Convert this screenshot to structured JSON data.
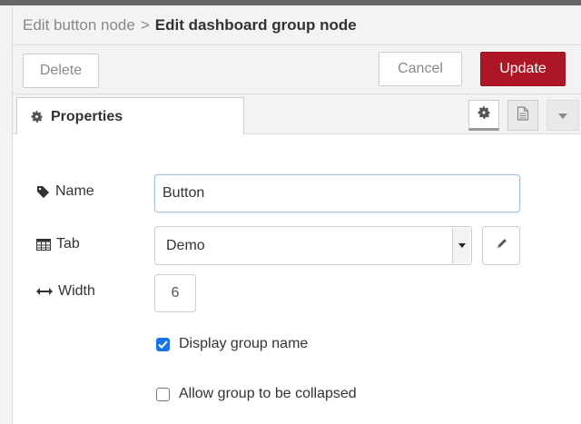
{
  "breadcrumb": {
    "parent": "Edit button node",
    "separator": ">",
    "current": "Edit dashboard group node"
  },
  "toolbar": {
    "delete_label": "Delete",
    "cancel_label": "Cancel",
    "update_label": "Update",
    "update_color": "#ad1625"
  },
  "tabs": {
    "properties_label": "Properties",
    "icons": [
      "gear-icon",
      "description-icon",
      "chevron-down-icon"
    ]
  },
  "form": {
    "name": {
      "label": "Name",
      "icon": "tag-icon",
      "value": "Button"
    },
    "tab": {
      "label": "Tab",
      "icon": "table-icon",
      "value": "Demo"
    },
    "width": {
      "label": "Width",
      "icon": "arrows-horizontal-icon",
      "value": "6"
    },
    "display_group_name": {
      "label": "Display group name",
      "checked": true
    },
    "allow_collapse": {
      "label": "Allow group to be collapsed",
      "checked": false
    }
  }
}
